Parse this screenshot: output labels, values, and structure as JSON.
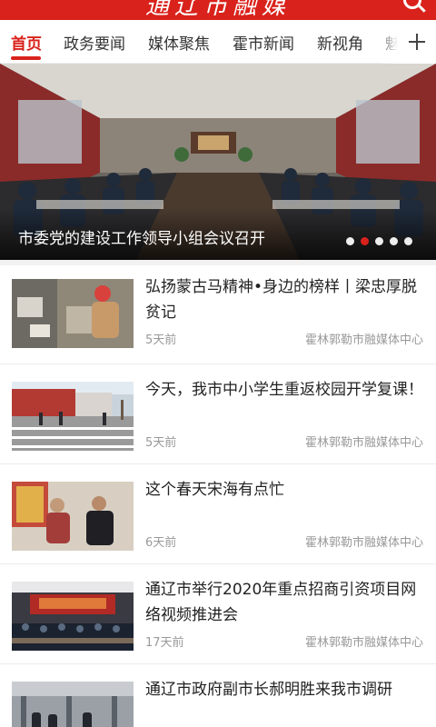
{
  "header": {
    "logo_text": "通辽市融媒"
  },
  "tabs": [
    {
      "label": "首页",
      "active": true
    },
    {
      "label": "政务要闻"
    },
    {
      "label": "媒体聚焦"
    },
    {
      "label": "霍市新闻"
    },
    {
      "label": "新视角"
    },
    {
      "label": "魅"
    }
  ],
  "banner": {
    "caption": "市委党的建设工作领导小组会议召开",
    "slide_count": 5,
    "active_slide": 2
  },
  "news": [
    {
      "title": "弘扬蒙古马精神•身边的榜样丨梁忠厚脱贫记",
      "time": "5天前",
      "source": "霍林郭勒市融媒体中心"
    },
    {
      "title": "今天，我市中小学生重返校园开学复课！",
      "time": "5天前",
      "source": "霍林郭勒市融媒体中心"
    },
    {
      "title": "这个春天宋海有点忙",
      "time": "6天前",
      "source": "霍林郭勒市融媒体中心"
    },
    {
      "title": "通辽市举行2020年重点招商引资项目网络视频推进会",
      "time": "17天前",
      "source": "霍林郭勒市融媒体中心"
    },
    {
      "title": "通辽市政府副市长郝明胜来我市调研",
      "time": "",
      "source": ""
    }
  ],
  "colors": {
    "accent": "#d9221b"
  }
}
